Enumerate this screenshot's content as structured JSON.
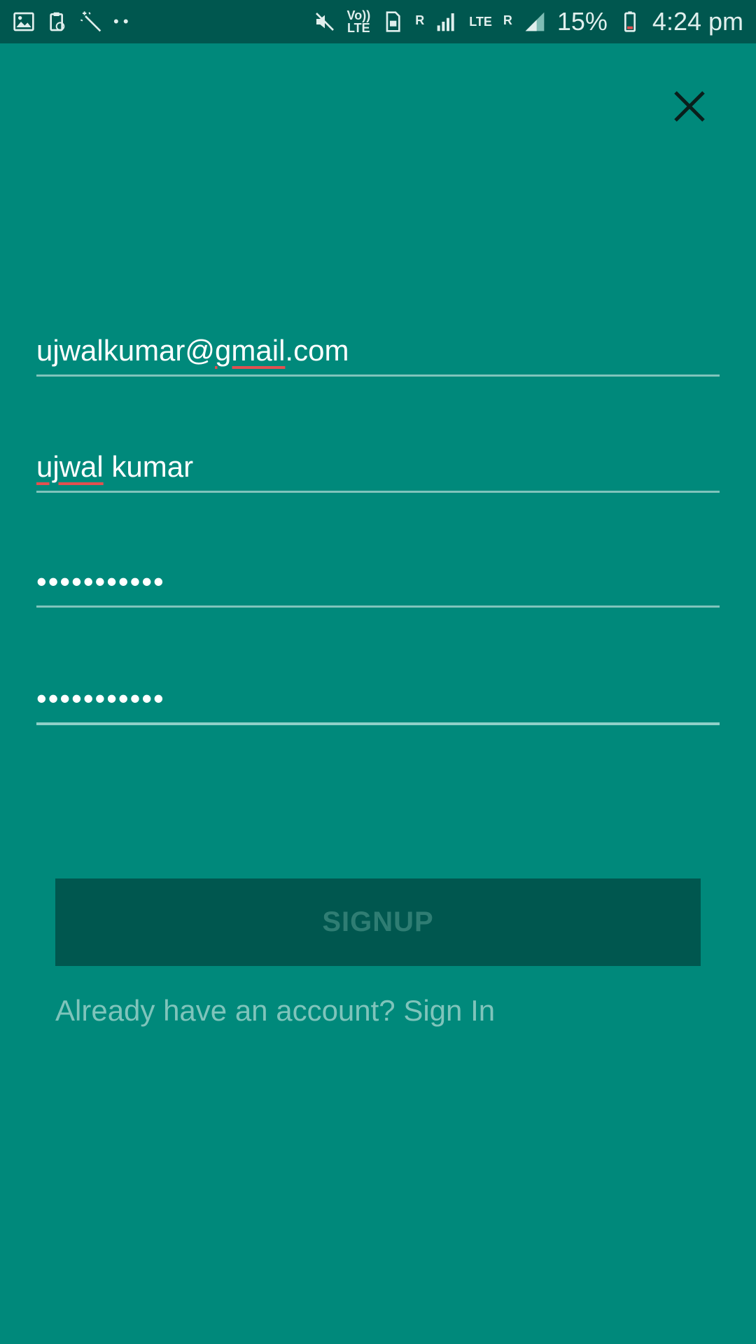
{
  "status_bar": {
    "battery_percent": "15%",
    "time": "4:24 pm",
    "volte_top": "Vo))",
    "volte_bottom": "LTE",
    "lte_label": "LTE",
    "roaming_1": "R",
    "roaming_2": "R",
    "notification_dots": "• •",
    "icons": [
      "image-icon",
      "clipboard-icon",
      "magic-wand-icon",
      "mute-icon",
      "sim-icon",
      "signal-icon",
      "battery-icon"
    ]
  },
  "form": {
    "email_value": "ujwalkumar@gmail.com",
    "email_parts": [
      "ujwalkumar@",
      "gmail",
      ".com"
    ],
    "name_value": "ujwal kumar",
    "name_parts": [
      "ujwal",
      " kumar"
    ],
    "password_value": "•••••••••••",
    "confirm_password_value": "•••••••••••",
    "signup_label": "SIGNUP",
    "signin_link": "Already have an account? Sign In"
  },
  "colors": {
    "background": "#00897b",
    "status_bar": "#00574f",
    "button_bg": "#00574f",
    "button_text": "#2f7d73",
    "link_text": "#7fc4bb",
    "spell_error": "#e25050"
  }
}
